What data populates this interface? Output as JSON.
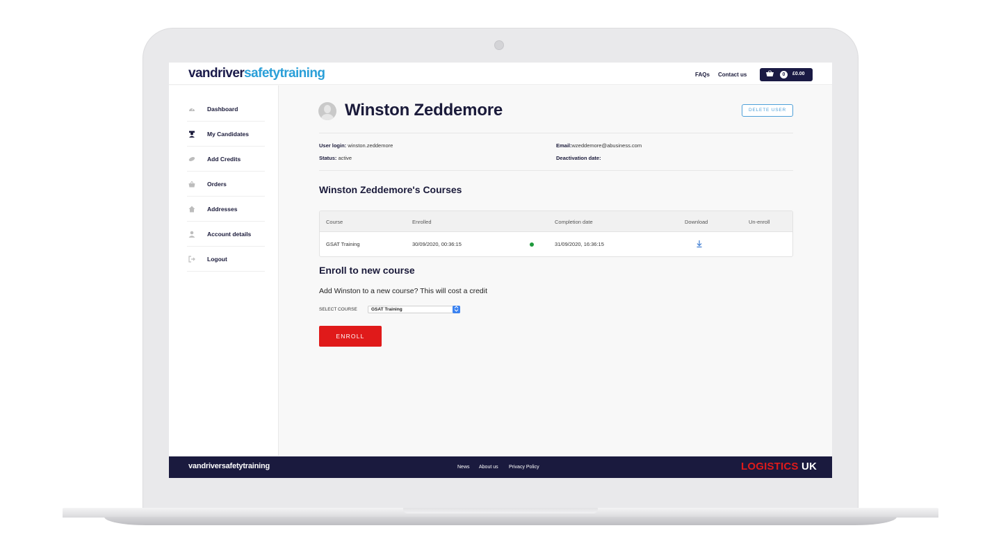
{
  "header": {
    "logo_part1": "vandriver",
    "logo_part2": "safetytraining",
    "faqs": "FAQs",
    "contact": "Contact us",
    "cart_count": "0",
    "cart_total": "£0.00"
  },
  "sidebar": {
    "items": [
      {
        "label": "Dashboard",
        "icon": "dashboard-icon"
      },
      {
        "label": "My Candidates",
        "icon": "candidates-icon"
      },
      {
        "label": "Add Credits",
        "icon": "credits-icon"
      },
      {
        "label": "Orders",
        "icon": "basket-icon"
      },
      {
        "label": "Addresses",
        "icon": "home-icon"
      },
      {
        "label": "Account details",
        "icon": "user-icon"
      },
      {
        "label": "Logout",
        "icon": "logout-icon"
      }
    ]
  },
  "profile": {
    "name": "Winston Zeddemore",
    "delete_label": "DELETE USER",
    "user_login_label": "User login:",
    "user_login": "winston.zeddemore",
    "status_label": "Status:",
    "status": "active",
    "email_label": "Email:",
    "email": "wzeddemore@abusiness.com",
    "deactivation_label": "Deactivation date:",
    "deactivation": ""
  },
  "courses": {
    "title": "Winston Zeddemore's Courses",
    "headers": [
      "Course",
      "Enrolled",
      "Completion date",
      "Download",
      "Un-enroll"
    ],
    "rows": [
      {
        "course": "GSAT Training",
        "enrolled": "30/09/2020, 00:36:15",
        "completion": "31/09/2020, 16:36:15",
        "status_color": "#1e9a3c"
      }
    ]
  },
  "enroll": {
    "title": "Enroll to new course",
    "description": "Add Winston to a new course? This will cost a credit",
    "select_label": "SELECT COURSE",
    "select_value": "GSAT Training",
    "button": "ENROLL"
  },
  "footer": {
    "logo": "vandriversafetytraining",
    "links": [
      "News",
      "About us",
      "Privacy Policy"
    ],
    "brand_part1": "LOGISTICS",
    "brand_part2": " UK"
  },
  "colors": {
    "navy": "#1a1a3a",
    "accent_blue": "#2a9fd8",
    "enroll_red": "#e01a1a"
  }
}
